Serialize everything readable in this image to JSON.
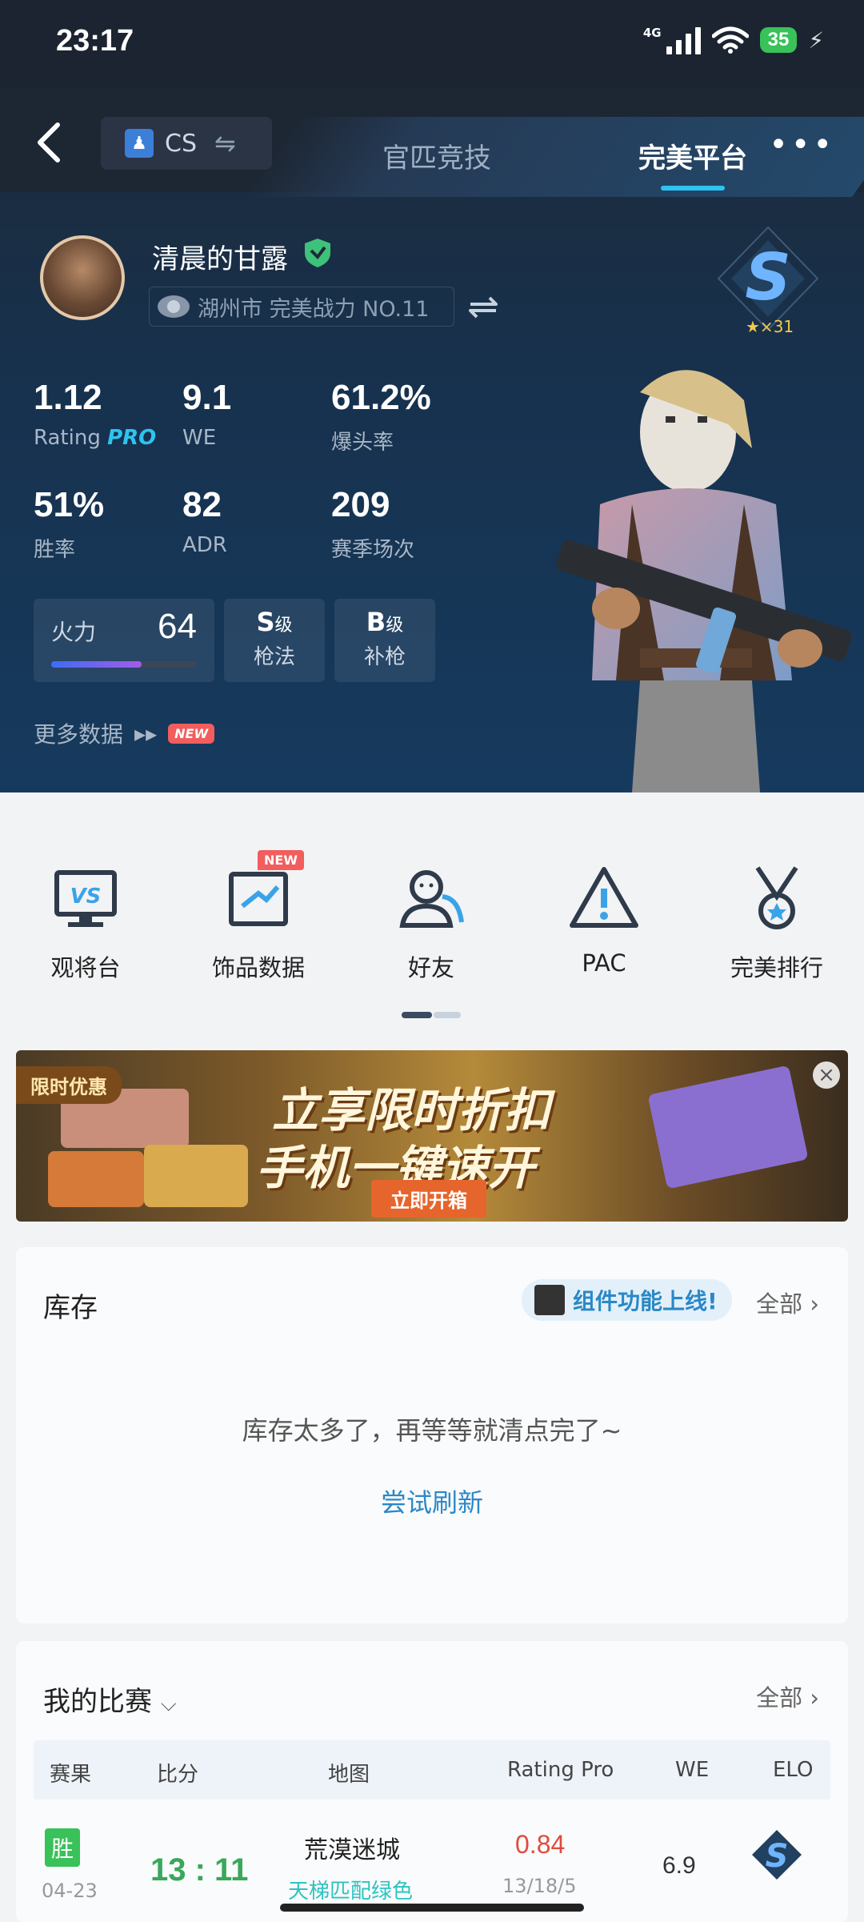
{
  "status_bar": {
    "time": "23:17",
    "network": "4G",
    "battery": "35"
  },
  "header": {
    "game": "CS",
    "tabs": [
      {
        "label": "官匹竞技"
      },
      {
        "label": "完美平台",
        "active": true
      }
    ]
  },
  "profile": {
    "name": "清晨的甘露",
    "location_rank": "湖州市 完美战力 NO.11",
    "badge_stars": "★×31"
  },
  "stats": [
    {
      "value": "1.12",
      "label": "Rating",
      "label_suffix": "PRO"
    },
    {
      "value": "9.1",
      "label": "WE"
    },
    {
      "value": "61.2%",
      "label": "爆头率"
    },
    {
      "value": "51%",
      "label": "胜率"
    },
    {
      "value": "82",
      "label": "ADR"
    },
    {
      "value": "209",
      "label": "赛季场次"
    }
  ],
  "firepower": {
    "label": "火力",
    "value": "64",
    "fill_fraction": 0.62
  },
  "grades": [
    {
      "grade": "S",
      "unit": "级",
      "label": "枪法"
    },
    {
      "grade": "B",
      "unit": "级",
      "label": "补枪"
    }
  ],
  "more_data": {
    "label": "更多数据",
    "new_tag": "NEW"
  },
  "quick_nav": [
    {
      "label": "观将台",
      "icon": "vs-monitor-icon"
    },
    {
      "label": "饰品数据",
      "icon": "skin-data-icon",
      "new_tag": "NEW"
    },
    {
      "label": "好友",
      "icon": "friends-icon"
    },
    {
      "label": "PAC",
      "icon": "pac-warning-icon"
    },
    {
      "label": "完美排行",
      "icon": "ranking-medal-icon"
    }
  ],
  "banner": {
    "tag": "限时优惠",
    "line1": "立享限时折扣",
    "line2": "手机一键速开",
    "cta": "立即开箱"
  },
  "inventory": {
    "title": "库存",
    "promo": "组件功能上线!",
    "all_label": "全部",
    "empty_text": "库存太多了，再等等就清点完了~",
    "retry_label": "尝试刷新"
  },
  "matches": {
    "title": "我的比赛",
    "all_label": "全部",
    "columns": [
      "赛果",
      "比分",
      "地图",
      "Rating Pro",
      "WE",
      "ELO"
    ],
    "rows": [
      {
        "result": "胜",
        "date": "04-23",
        "score": "13 : 11",
        "map": "荒漠迷城",
        "mode": "天梯匹配绿色",
        "rating": "0.84",
        "kda": "13/18/5",
        "we": "6.9"
      }
    ]
  },
  "colors": {
    "accent": "#2ec3f0",
    "win": "#39c15a",
    "loss_rating": "#e04c3c",
    "link": "#2a88c7",
    "new_tag": "#f25d5d"
  }
}
